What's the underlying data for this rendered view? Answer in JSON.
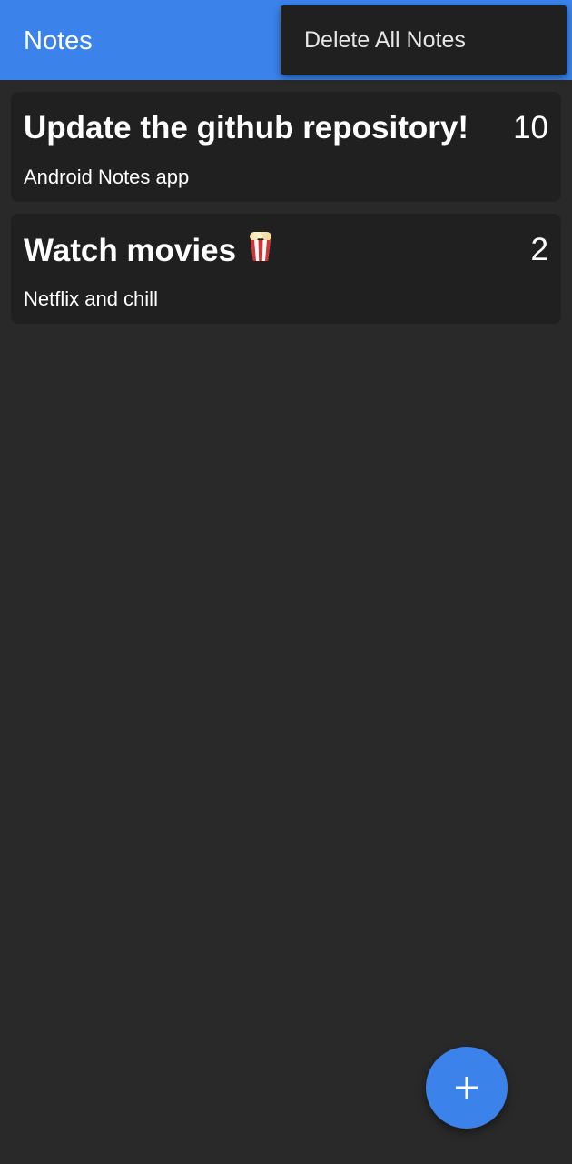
{
  "app_bar": {
    "title": "Notes",
    "background_color": "#3b82ea"
  },
  "overflow_menu": {
    "items": [
      {
        "label": "Delete All Notes"
      }
    ]
  },
  "notes": [
    {
      "title": "Update the github repository!",
      "description": "Android Notes app",
      "priority": "10"
    },
    {
      "title": "Watch movies",
      "title_icon": "popcorn-icon",
      "description": "Netflix and chill",
      "priority": "2"
    }
  ],
  "fab": {
    "icon": "plus-icon",
    "color": "#3b82ea"
  },
  "colors": {
    "background": "#292929",
    "card": "#202020"
  }
}
